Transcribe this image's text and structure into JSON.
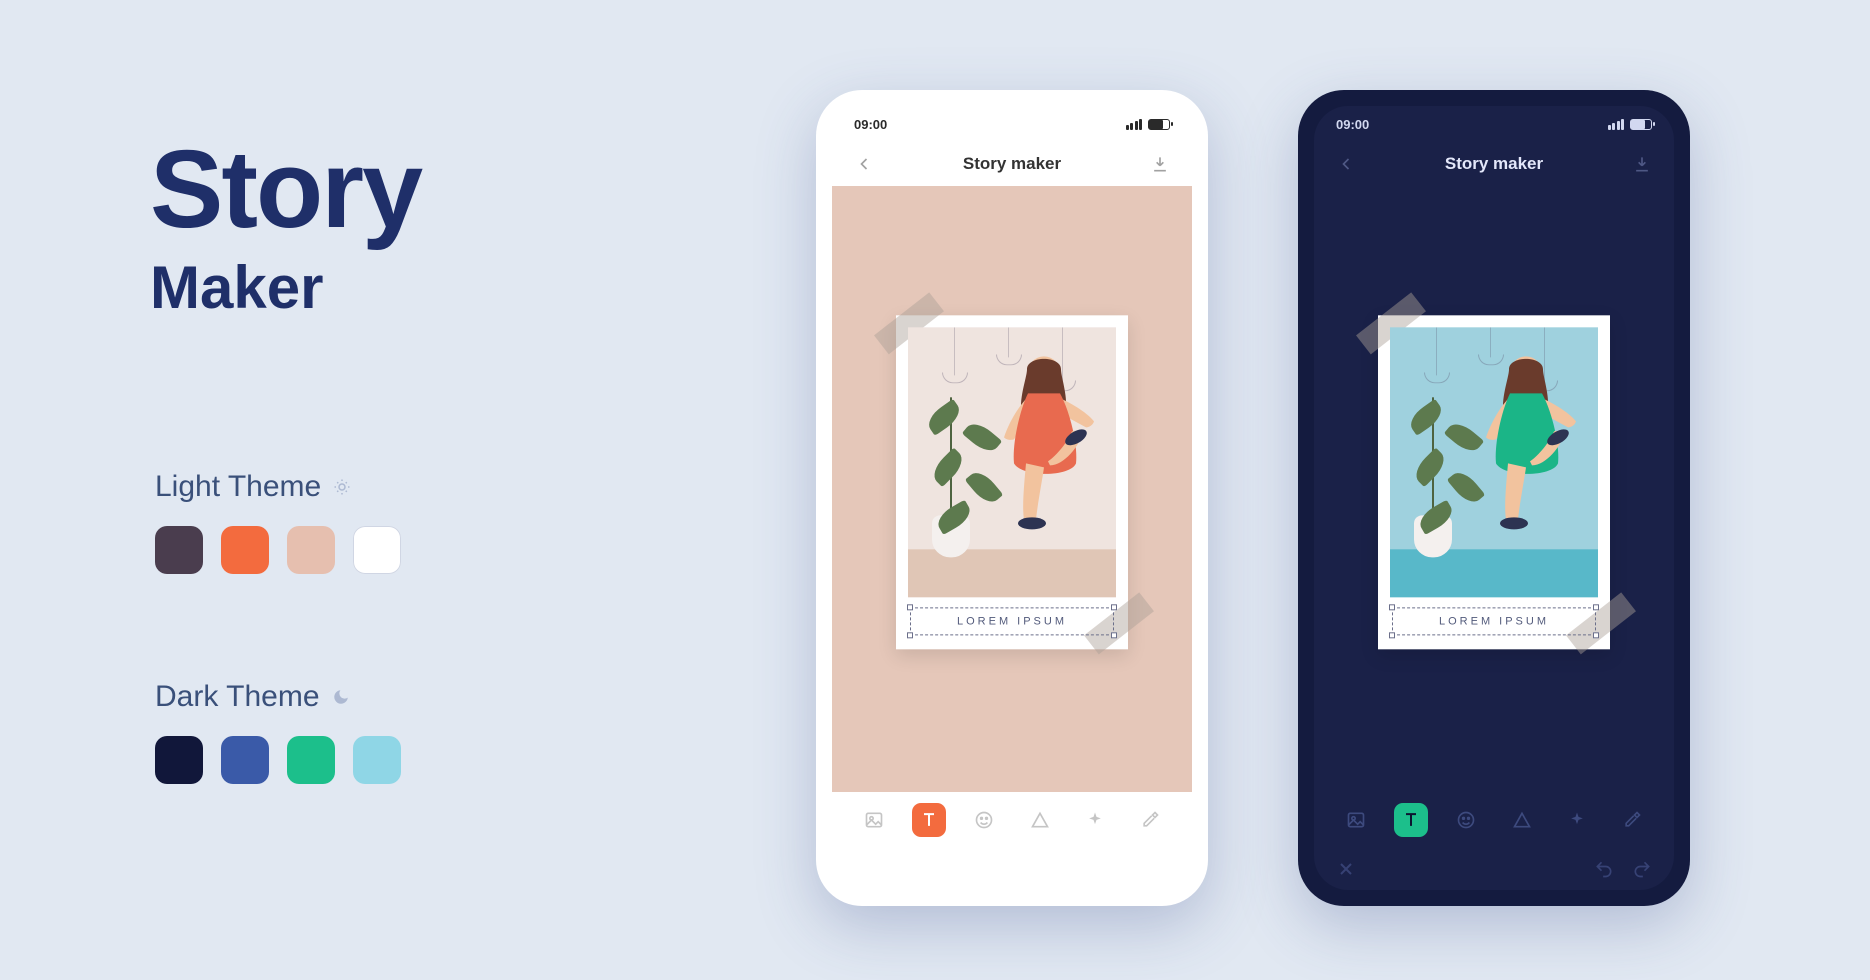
{
  "page": {
    "title_line1": "Story",
    "title_line2": "Maker"
  },
  "themes": {
    "light": {
      "label": "Light Theme",
      "swatches": [
        "#4a3d4e",
        "#f36b3e",
        "#e6bfaf",
        "#ffffff"
      ]
    },
    "dark": {
      "label": "Dark Theme",
      "swatches": [
        "#11173a",
        "#3a5aa8",
        "#1cbf8b",
        "#8fd6e6"
      ]
    }
  },
  "phone": {
    "time": "09:00",
    "header_title": "Story maker",
    "caption_text": "LOREM IPSUM",
    "tools": [
      "image",
      "text",
      "emoji",
      "shape",
      "sparkle",
      "eyedropper"
    ],
    "active_tool": "text"
  },
  "illustration": {
    "light": {
      "bg": "#efe4df",
      "floor": "#e0c6b6",
      "dress": "#e86a4f",
      "skin": "#f2c39e"
    },
    "dark": {
      "bg": "#9fd1de",
      "floor": "#58b8c9",
      "dress": "#1bb587",
      "skin": "#f2c39e"
    }
  }
}
